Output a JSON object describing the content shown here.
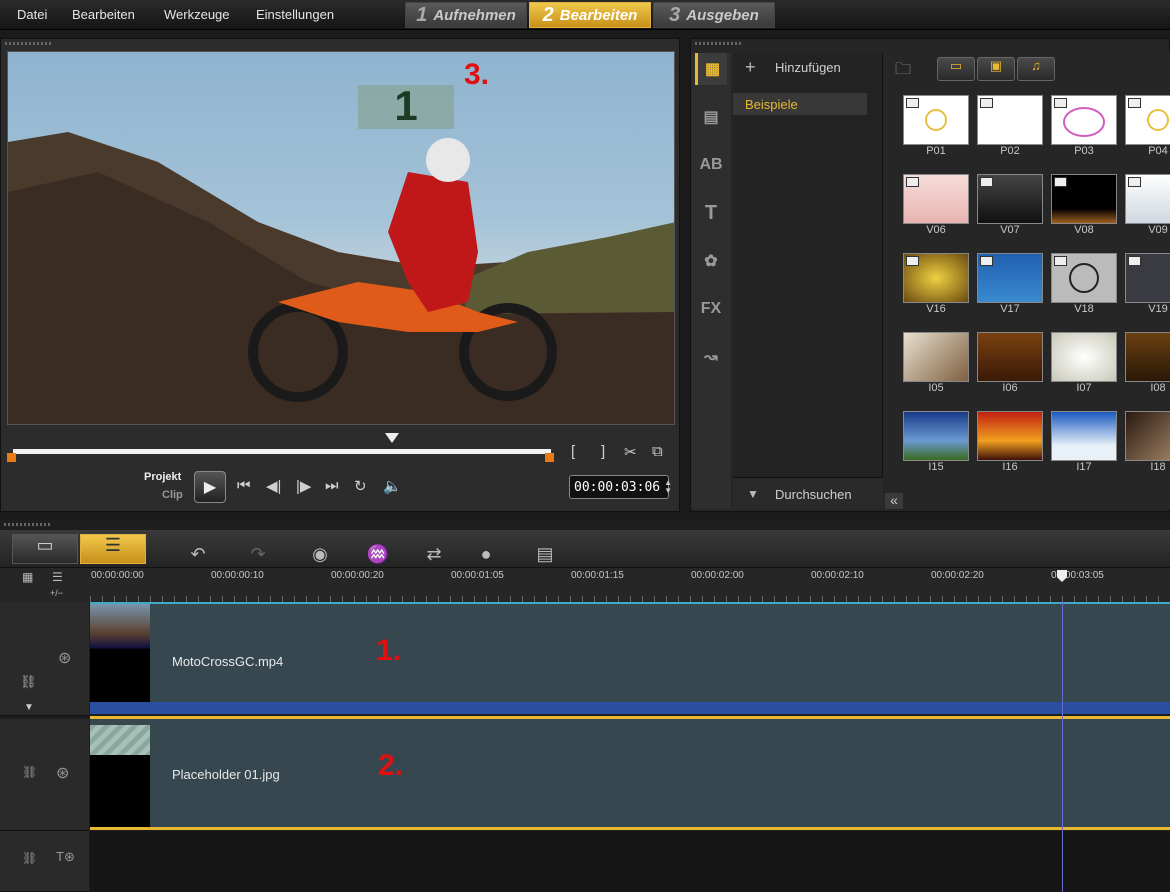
{
  "menu": [
    "Datei",
    "Bearbeiten",
    "Werkzeuge",
    "Einstellungen"
  ],
  "steps": [
    {
      "num": "1",
      "label": "Aufnehmen"
    },
    {
      "num": "2",
      "label": "Bearbeiten"
    },
    {
      "num": "3",
      "label": "Ausgeben"
    }
  ],
  "preview": {
    "overlay_badge": "1",
    "annotation": "3.",
    "mode_project": "Projekt",
    "mode_clip": "Clip",
    "timecode": "00:00:03:06",
    "mark_in": "[",
    "mark_out": "]"
  },
  "library": {
    "add_label": "Hinzufügen",
    "folder_item": "Beispiele",
    "browse_label": "Durchsuchen",
    "collapse": "«",
    "side_icons": [
      "media-icon",
      "instant-project-icon",
      "transition-icon",
      "title-icon",
      "graphic-icon",
      "filter-icon",
      "path-icon"
    ],
    "thumbnails": [
      [
        "P01",
        "P02",
        "P03",
        "P04"
      ],
      [
        "V06",
        "V07",
        "V08",
        "V09"
      ],
      [
        "V16",
        "V17",
        "V18",
        "V19"
      ],
      [
        "I05",
        "I06",
        "I07",
        "I08"
      ],
      [
        "I15",
        "I16",
        "I17",
        "I18"
      ]
    ]
  },
  "timeline": {
    "ruler": [
      "00:00:00:00",
      "00:00:00:10",
      "00:00:00:20",
      "00:00:01:05",
      "00:00:01:15",
      "00:00:02:00",
      "00:00:02:10",
      "00:00:02:20",
      "00:00:03:05"
    ],
    "tracks": [
      {
        "clip": "MotoCrossGC.mp4",
        "annotation": "1."
      },
      {
        "clip": "Placeholder 01.jpg",
        "annotation": "2."
      }
    ],
    "ruler_ctrl": "+/−"
  },
  "colors": {
    "accent": "#e8b830",
    "annotation": "#e01010",
    "clip": "#37474f"
  }
}
